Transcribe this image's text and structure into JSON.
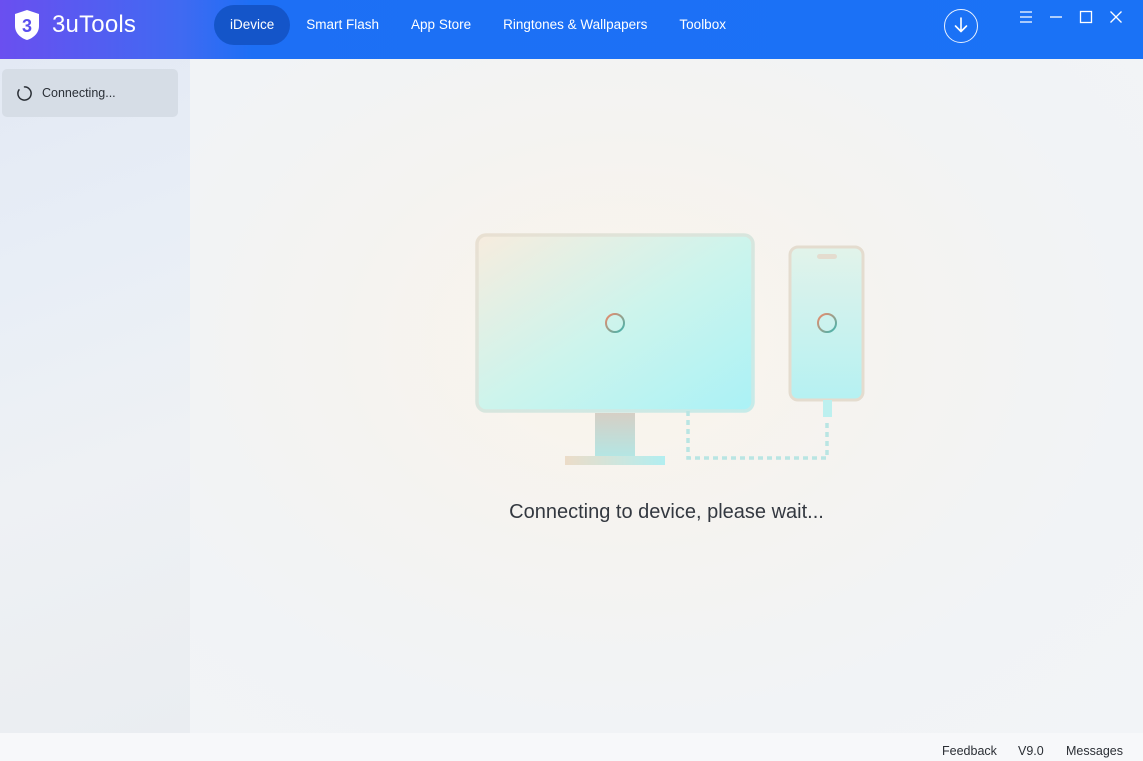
{
  "app": {
    "name": "3uTools",
    "logo_glyph": "3"
  },
  "nav": {
    "tabs": [
      {
        "label": "iDevice",
        "active": true
      },
      {
        "label": "Smart Flash",
        "active": false
      },
      {
        "label": "App Store",
        "active": false
      },
      {
        "label": "Ringtones & Wallpapers",
        "active": false
      },
      {
        "label": "Toolbox",
        "active": false
      }
    ]
  },
  "toolbar": {
    "download_icon": "download-icon",
    "menu_icon": "menu-icon",
    "minimize_icon": "minimize-icon",
    "maximize_icon": "maximize-icon",
    "close_icon": "close-icon"
  },
  "sidebar": {
    "device_status": "Connecting..."
  },
  "main": {
    "status_text": "Connecting to device, please wait..."
  },
  "footer": {
    "feedback": "Feedback",
    "version": "V9.0",
    "messages": "Messages"
  },
  "colors": {
    "titlebar": "#1a72f6",
    "active_tab": "#1455c9",
    "brand_purple": "#6a4ff0"
  }
}
